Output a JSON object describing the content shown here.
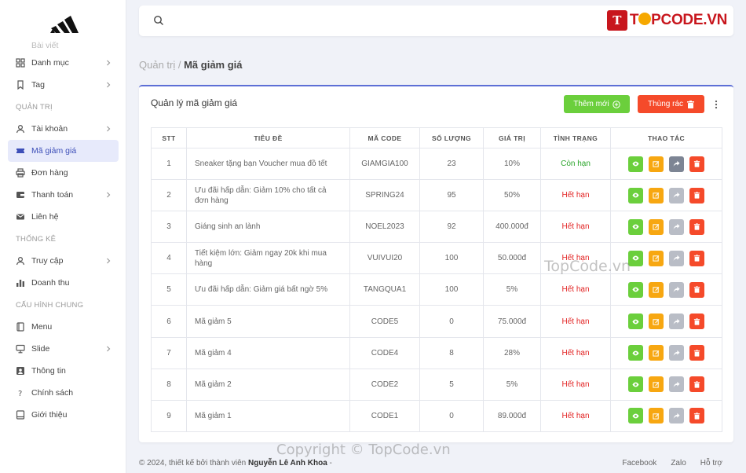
{
  "sidebar": {
    "faded_item": "Bài viết",
    "group1": [
      {
        "label": "Danh mục",
        "icon": "grid-icon",
        "chevron": true
      },
      {
        "label": "Tag",
        "icon": "bookmark-icon",
        "chevron": true
      }
    ],
    "section_admin": "QUẢN TRỊ",
    "group2": [
      {
        "label": "Tài khoản",
        "icon": "user-icon",
        "chevron": true
      },
      {
        "label": "Mã giảm giá",
        "icon": "ticket-icon",
        "chevron": false,
        "active": true
      },
      {
        "label": "Đơn hàng",
        "icon": "printer-icon",
        "chevron": false
      },
      {
        "label": "Thanh toán",
        "icon": "wallet-icon",
        "chevron": true
      },
      {
        "label": "Liên hệ",
        "icon": "mail-icon",
        "chevron": false
      }
    ],
    "section_stats": "THỐNG KÊ",
    "group3": [
      {
        "label": "Truy cập",
        "icon": "user-icon",
        "chevron": true
      },
      {
        "label": "Doanh thu",
        "icon": "bar-chart-icon",
        "chevron": false
      }
    ],
    "section_config": "CẤU HÌNH CHUNG",
    "group4": [
      {
        "label": "Menu",
        "icon": "book-icon",
        "chevron": false
      },
      {
        "label": "Slide",
        "icon": "monitor-icon",
        "chevron": true
      },
      {
        "label": "Thông tin",
        "icon": "id-card-icon",
        "chevron": false
      },
      {
        "label": "Chính sách",
        "icon": "question-icon",
        "chevron": false
      },
      {
        "label": "Giới thiệu",
        "icon": "book-open-icon",
        "chevron": false
      }
    ]
  },
  "brand": {
    "box": "T",
    "text_before": "T",
    "text_after": "PCODE.VN"
  },
  "breadcrumb": {
    "root": "Quản trị",
    "sep": " / ",
    "current": "Mã giảm giá"
  },
  "card": {
    "title": "Quản lý mã giảm giá",
    "add_label": "Thêm mới",
    "trash_label": "Thùng rác"
  },
  "table": {
    "headers": [
      "STT",
      "Tiêu đề",
      "Mã code",
      "Số lượng",
      "Giá trị",
      "Tình trạng",
      "Thao tác"
    ],
    "rows": [
      {
        "stt": "1",
        "title": "Sneaker tặng bạn Voucher mua đồ tết",
        "code": "GIAMGIA100",
        "qty": "23",
        "value": "10%",
        "status": "Còn hạn",
        "ok": true
      },
      {
        "stt": "2",
        "title": "Ưu đãi hấp dẫn: Giảm 10% cho tất cả đơn hàng",
        "code": "SPRING24",
        "qty": "95",
        "value": "50%",
        "status": "Hết hạn",
        "ok": false
      },
      {
        "stt": "3",
        "title": "Giáng sinh an lành",
        "code": "NOEL2023",
        "qty": "92",
        "value": "400.000đ",
        "status": "Hết hạn",
        "ok": false
      },
      {
        "stt": "4",
        "title": "Tiết kiệm lớn: Giảm ngay 20k khi mua hàng",
        "code": "VUIVUI20",
        "qty": "100",
        "value": "50.000đ",
        "status": "Hết hạn",
        "ok": false
      },
      {
        "stt": "5",
        "title": "Ưu đãi hấp dẫn: Giảm giá bất ngờ 5%",
        "code": "TANGQUA1",
        "qty": "100",
        "value": "5%",
        "status": "Hết hạn",
        "ok": false
      },
      {
        "stt": "6",
        "title": "Mã giảm 5",
        "code": "CODE5",
        "qty": "0",
        "value": "75.000đ",
        "status": "Hết hạn",
        "ok": false
      },
      {
        "stt": "7",
        "title": "Mã giảm 4",
        "code": "CODE4",
        "qty": "8",
        "value": "28%",
        "status": "Hết hạn",
        "ok": false
      },
      {
        "stt": "8",
        "title": "Mã giảm 2",
        "code": "CODE2",
        "qty": "5",
        "value": "5%",
        "status": "Hết hạn",
        "ok": false
      },
      {
        "stt": "9",
        "title": "Mã giảm 1",
        "code": "CODE1",
        "qty": "0",
        "value": "89.000đ",
        "status": "Hết hạn",
        "ok": false
      }
    ]
  },
  "footer": {
    "text": "© 2024, thiết kế bởi thành viên ",
    "author": "Nguyễn Lê Anh Khoa",
    "dash": " -",
    "links": [
      "Facebook",
      "Zalo",
      "Hỗ trợ"
    ]
  },
  "watermarks": {
    "center": "TopCode.vn",
    "bottom": "Copyright © TopCode.vn"
  },
  "colors": {
    "accent": "#5d6fd6",
    "add": "#6bcf3c",
    "trash": "#f54a2a",
    "edit": "#f7a711",
    "ok": "#2aa52a",
    "expired": "#e22222"
  }
}
